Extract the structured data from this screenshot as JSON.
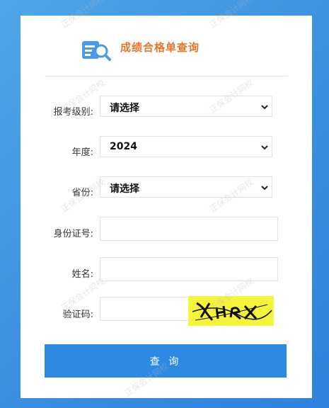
{
  "header": {
    "title": "成绩合格单查询",
    "logo_icon": "search-document-icon",
    "accent_color": "#e8742a"
  },
  "form": {
    "level": {
      "label": "报考级别:",
      "value": "请选择"
    },
    "year": {
      "label": "年度:",
      "value": "2024"
    },
    "province": {
      "label": "省份:",
      "value": "请选择"
    },
    "id_card": {
      "label": "身份证号:",
      "value": ""
    },
    "name": {
      "label": "姓名:",
      "value": ""
    },
    "captcha": {
      "label": "验证码:",
      "value": ""
    }
  },
  "submit": {
    "label": "查 询",
    "color": "#2d8ae2"
  },
  "watermark": {
    "text": "正保会计网校"
  }
}
